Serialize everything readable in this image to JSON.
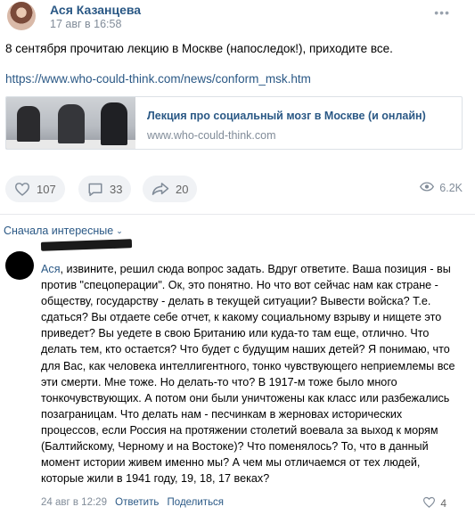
{
  "post": {
    "author": "Ася Казанцева",
    "date": "17 авг в 16:58",
    "more": "•••",
    "text": "8 сентября прочитаю лекцию в Москве (напоследок!), приходите все.",
    "link": "https://www.who-could-think.com/news/conform_msk.htm",
    "snippet": {
      "title": "Лекция про социальный мозг в Москве (и онлайн)",
      "domain": "www.who-could-think.com"
    },
    "actions": {
      "likes": "107",
      "comments": "33",
      "shares": "20",
      "views": "6.2K"
    }
  },
  "comments_section": {
    "sort_label": "Сначала интересные",
    "comment": {
      "reply_to": "Ася",
      "text": ", извините, решил сюда вопрос задать. Вдруг ответите. Ваша позиция - вы против \"спецоперации\". Ок, это понятно. Но что вот сейчас нам как стране - обществу, государству - делать в текущей ситуации? Вывести войска? Т.е. сдаться? Вы отдаете себе отчет, к какому социальному взрыву и нищете это приведет? Вы уедете в свою Британию или куда-то там еще, отлично. Что делать тем, кто остается? Что будет с будущим наших детей? Я понимаю, что для Вас, как человека интеллигентного, тонко чувствующего неприемлемы все эти смерти. Мне тоже. Но делать-то что? В 1917-м тоже было много тонкочувствующих. А потом они были уничтожены как класс или разбежались позаграницам. Что делать нам - песчинкам в жерновах исторических процессов, если Россия на протяжении столетий воевала за выход к морям (Балтийскому, Черному и на Востоке)? Что поменялось? То, что в данный момент истории живем именно мы? А чем мы отличаемся от тех людей, которые жили в 1941 году, 19, 18, 17 веках?",
      "date": "24 авг в 12:29",
      "reply_label": "Ответить",
      "share_label": "Поделиться",
      "likes": "4"
    }
  }
}
